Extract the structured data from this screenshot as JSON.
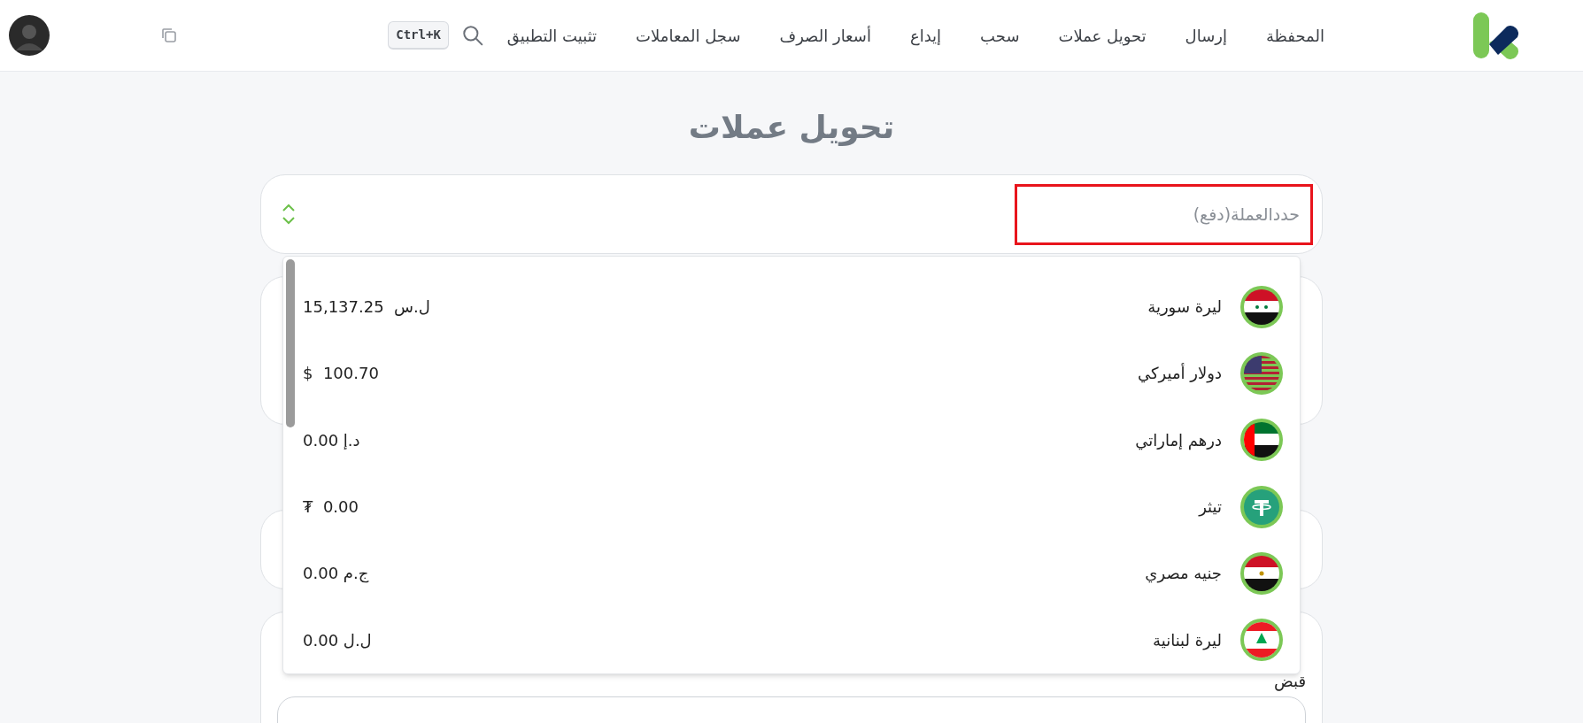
{
  "header": {
    "nav": [
      "المحفظة",
      "إرسال",
      "تحويل عملات",
      "سحب",
      "إيداع",
      "أسعار الصرف",
      "سجل المعاملات",
      "تثبيت التطبيق"
    ],
    "shortcut": "Ctrl+K"
  },
  "page_title": "تحويل عملات",
  "currency_select": {
    "placeholder": "حددالعملة(دفع)"
  },
  "currencies": [
    {
      "name": "ليرة سورية",
      "balance": "15,137.25  ل.س",
      "kind": "syria"
    },
    {
      "name": "دولار أميركي",
      "balance": "$  100.70",
      "kind": "usa"
    },
    {
      "name": "درهم إماراتي",
      "balance": "0.00 د.إ",
      "kind": "uae"
    },
    {
      "name": "تيثر",
      "balance": "₮  0.00",
      "kind": "tether"
    },
    {
      "name": "جنيه مصري",
      "balance": "0.00 ج.م",
      "kind": "egypt"
    },
    {
      "name": "ليرة لبنانية",
      "balance": "0.00 ل.ل",
      "kind": "lebanon"
    }
  ],
  "receive_label": "قبض"
}
